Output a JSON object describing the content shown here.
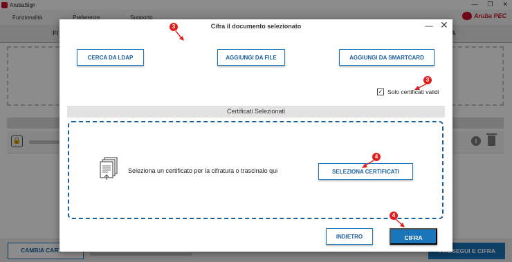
{
  "app": {
    "title": "ArubaSign",
    "brand": "Aruba PEC",
    "menu": [
      "Funzionalità",
      "Preferenze",
      "Supporto"
    ],
    "window_controls": [
      "—",
      "❐",
      "✕"
    ]
  },
  "background": {
    "tab_left": "FI",
    "tab_right": "A",
    "bottom_left_button": "CAMBIA CART",
    "bottom_right_button": "PROSEGUI E CIFRA"
  },
  "dialog": {
    "title": "Cifra il documento selezionato",
    "minimize_glyph": "—",
    "close_glyph": "✕",
    "buttons": {
      "ldap": "CERCA DA LDAP",
      "file": "AGGIUNGI DA FILE",
      "smartcard": "AGGIUNGI DA SMARTCARD",
      "select_certs": "SELEZIONA CERTIFICATI",
      "back": "INDIETRO",
      "sign": "CIFRA"
    },
    "checkbox": {
      "label": "Solo certificati validi",
      "checked": true,
      "mark": "✓"
    },
    "selected_section": {
      "header": "Certificati Selezionati",
      "hint": "Seleziona un certificato per la cifratura o trascinalo qui"
    }
  },
  "annotations": [
    {
      "id": "step-3-title",
      "label": "3"
    },
    {
      "id": "step-3-checkbox",
      "label": "3"
    },
    {
      "id": "step-4-select",
      "label": "4"
    },
    {
      "id": "step-4-sign",
      "label": "4"
    }
  ],
  "colors": {
    "accent": "#1b75bb",
    "accent_dark": "#1b5e9e",
    "brand_red": "#c8102e",
    "annotation_red": "#e01e1e"
  }
}
